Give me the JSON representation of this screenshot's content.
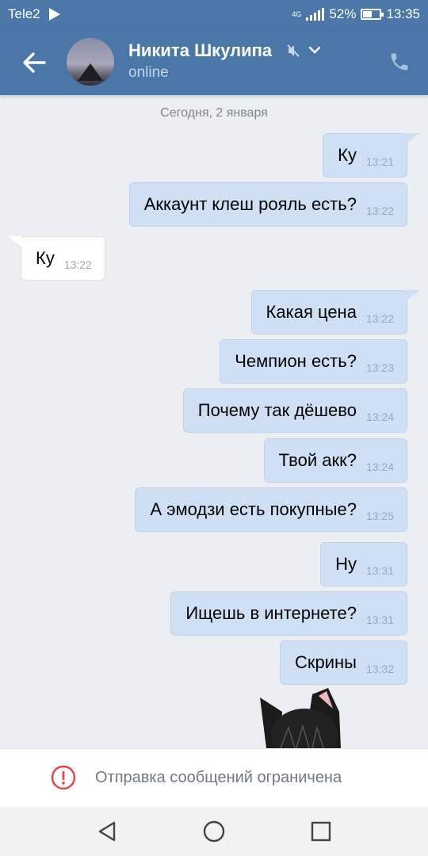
{
  "status_bar": {
    "carrier": "Tele2",
    "network": "4G",
    "battery_percent": "52%",
    "battery_level": 0.52,
    "time": "13:35"
  },
  "header": {
    "contact_name": "Никита Шкулипа",
    "status": "online",
    "muted": true
  },
  "chat": {
    "date_label": "Сегодня, 2 января",
    "messages": [
      {
        "text": "Ку",
        "time": "13:21",
        "direction": "out"
      },
      {
        "text": "Аккаунт клеш рояль есть?",
        "time": "13:22",
        "direction": "out"
      },
      {
        "text": "Ку",
        "time": "13:22",
        "direction": "in"
      },
      {
        "text": "Какая цена",
        "time": "13:22",
        "direction": "out"
      },
      {
        "text": "Чемпион есть?",
        "time": "13:23",
        "direction": "out"
      },
      {
        "text": "Почему так дёшево",
        "time": "13:24",
        "direction": "out"
      },
      {
        "text": "Твой акк?",
        "time": "13:24",
        "direction": "out"
      },
      {
        "text": "А эмодзи есть покупные?",
        "time": "13:25",
        "direction": "out"
      },
      {
        "text": "Ну",
        "time": "13:31",
        "direction": "out"
      },
      {
        "text": "Ищешь в интернете?",
        "time": "13:31",
        "direction": "out"
      },
      {
        "text": "Скрины",
        "time": "13:32",
        "direction": "out"
      }
    ]
  },
  "footer": {
    "restricted_text": "Отправка сообщений ограничена"
  },
  "colors": {
    "header": "#4a76a8",
    "outgoing_bubble": "#cfe0f5",
    "incoming_bubble": "#ffffff",
    "background": "#ebeef2",
    "warning": "#e64646"
  }
}
